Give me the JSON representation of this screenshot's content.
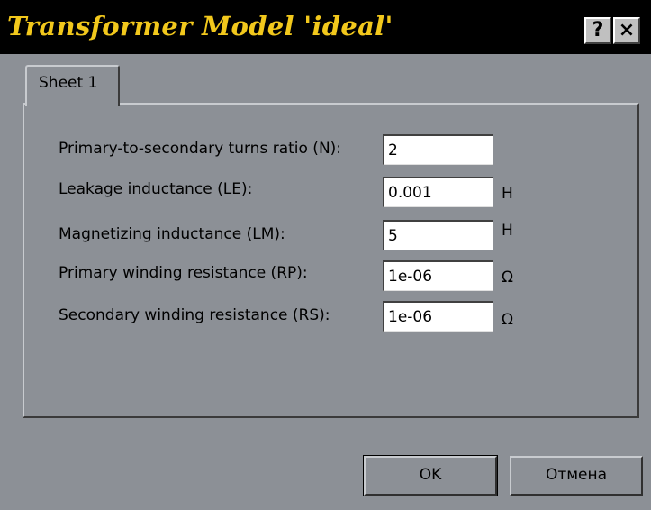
{
  "window": {
    "title": "Transformer Model 'ideal'",
    "help_label": "?",
    "close_label": "×"
  },
  "tabs": [
    {
      "label": "Sheet 1",
      "active": true
    }
  ],
  "params": [
    {
      "label": "Primary-to-secondary turns ratio (N):",
      "value": "2",
      "unit": ""
    },
    {
      "label": "Leakage inductance (LE):",
      "value": "0.001",
      "unit": "H"
    },
    {
      "label": "Magnetizing inductance (LM):",
      "value": "5",
      "unit": "H"
    },
    {
      "label": "Primary winding resistance (RP):",
      "value": "1e-06",
      "unit": "Ω"
    },
    {
      "label": "Secondary winding resistance (RS):",
      "value": "1e-06",
      "unit": "Ω"
    }
  ],
  "buttons": {
    "ok_label": "OK",
    "cancel_label": "Отмена"
  },
  "colors": {
    "titlebar_bg": "#000000",
    "title_text": "#f2c81c",
    "dialog_bg": "#8c9096"
  }
}
